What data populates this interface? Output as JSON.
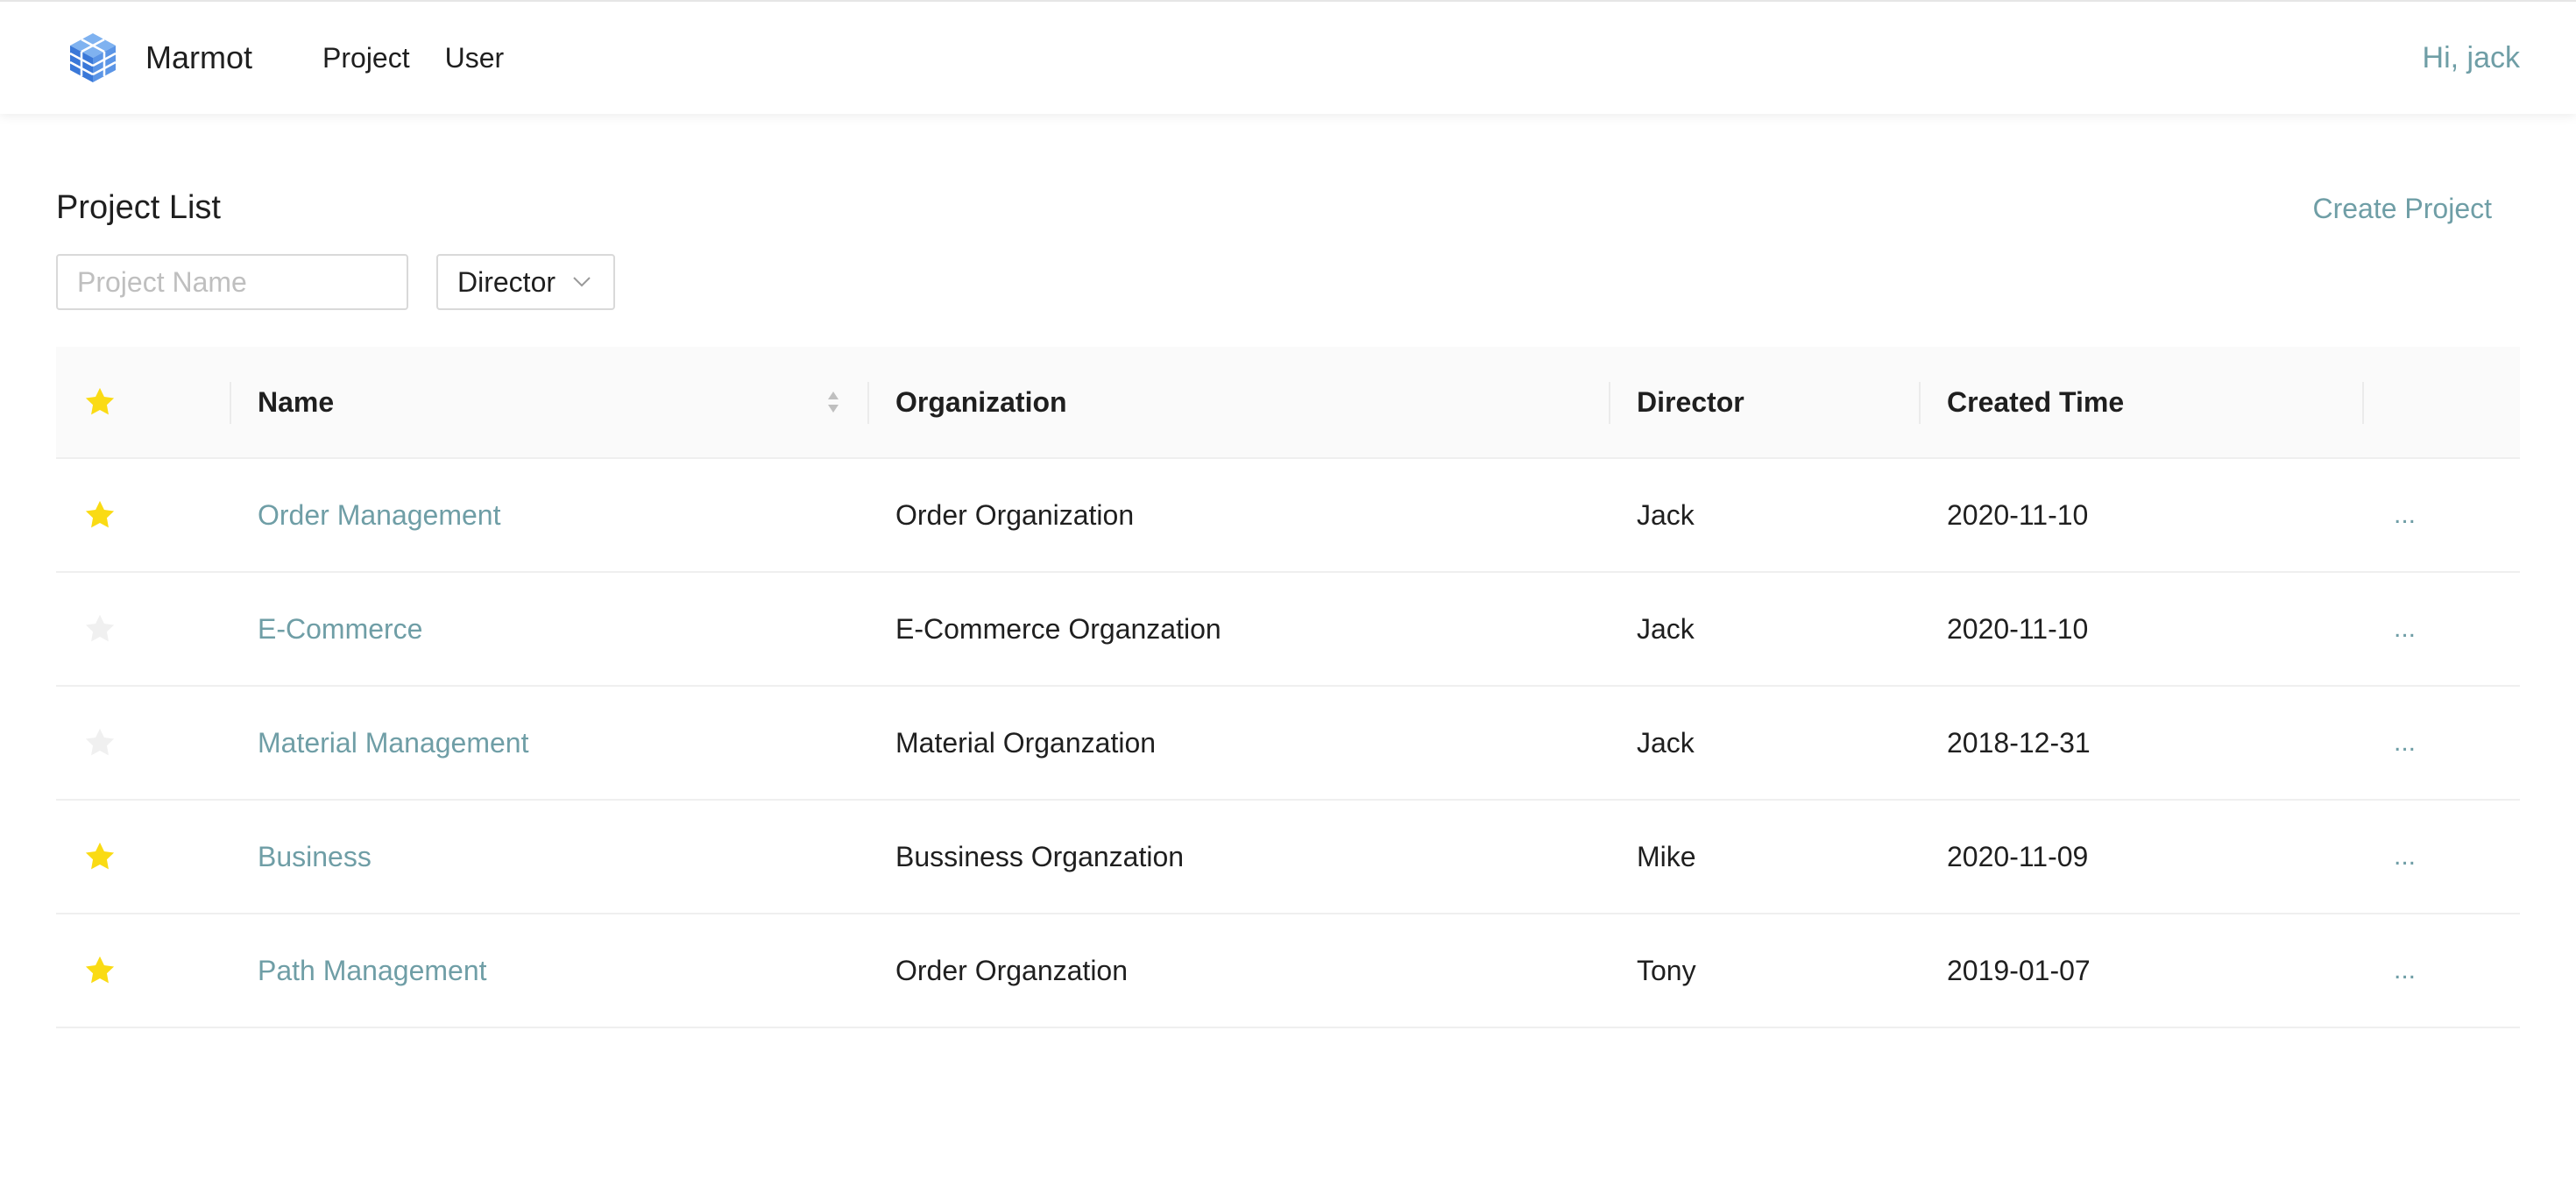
{
  "app": {
    "brand": "Marmot",
    "nav": [
      {
        "label": "Project"
      },
      {
        "label": "User"
      }
    ],
    "greeting": "Hi, jack"
  },
  "page": {
    "title": "Project List",
    "create_label": "Create Project",
    "filters": {
      "name_placeholder": "Project Name",
      "name_value": "",
      "director_selected": "Director"
    }
  },
  "table": {
    "columns": {
      "name": "Name",
      "organization": "Organization",
      "director": "Director",
      "created": "Created Time"
    },
    "rows": [
      {
        "starred": true,
        "name": "Order Management",
        "organization": "Order Organization",
        "director": "Jack",
        "created": "2020-11-10",
        "more": "..."
      },
      {
        "starred": false,
        "name": "E-Commerce",
        "organization": "E-Commerce Organzation",
        "director": "Jack",
        "created": "2020-11-10",
        "more": "..."
      },
      {
        "starred": false,
        "name": "Material Management",
        "organization": "Material Organzation",
        "director": "Jack",
        "created": "2018-12-31",
        "more": "..."
      },
      {
        "starred": true,
        "name": "Business",
        "organization": "Bussiness Organzation",
        "director": "Mike",
        "created": "2020-11-09",
        "more": "..."
      },
      {
        "starred": true,
        "name": "Path Management",
        "organization": "Order Organzation",
        "director": "Tony",
        "created": "2019-01-07",
        "more": "..."
      }
    ]
  },
  "colors": {
    "accent": "#6f9ea6",
    "star_on": "#fadb14",
    "star_off": "#f0f0f0"
  },
  "icons": {
    "logo": "cube-logo-icon",
    "star": "star-icon",
    "sort": "sort-icon",
    "chevron": "chevron-down-icon"
  }
}
